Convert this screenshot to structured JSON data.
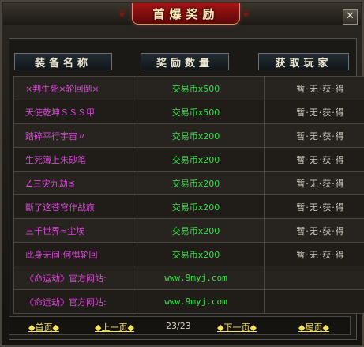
{
  "window": {
    "title": "首爆奖励",
    "close_label": "✕"
  },
  "headers": {
    "equip_name": "装备名称",
    "reward_amount": "奖励数量",
    "winner": "获取玩家"
  },
  "rows": [
    {
      "name": "×判生死×轮回倒×",
      "reward": "交易币x500",
      "player": "暂·无·获·得"
    },
    {
      "name": "天使乾坤ＳＳＳ甲",
      "reward": "交易币x500",
      "player": "暂·无·获·得"
    },
    {
      "name": "踏碎平行宇宙〃",
      "reward": "交易币x200",
      "player": "暂·无·获·得"
    },
    {
      "name": "生死簿上朱砂笔",
      "reward": "交易币x200",
      "player": "暂·无·获·得"
    },
    {
      "name": "∠三灾九劫≦",
      "reward": "交易币x200",
      "player": "暂·无·获·得"
    },
    {
      "name": "斷了这苍穹作战旗",
      "reward": "交易币x200",
      "player": "暂·无·获·得"
    },
    {
      "name": "三千世界≈尘埃",
      "reward": "交易币x200",
      "player": "暂·无·获·得"
    },
    {
      "name": "此身无间·何惧轮回",
      "reward": "交易币x200",
      "player": "暂·无·获·得"
    },
    {
      "name": "《命运劫》官方网站:",
      "reward": "www.9myj.com",
      "player": ""
    },
    {
      "name": "《命运劫》官方网站:",
      "reward": "www.9myj.com",
      "player": ""
    }
  ],
  "pager": {
    "first": "◆首页◆",
    "prev": "◆上一页◆",
    "page": "23/23",
    "next": "◆下一页◆",
    "last": "◆尾页◆"
  }
}
